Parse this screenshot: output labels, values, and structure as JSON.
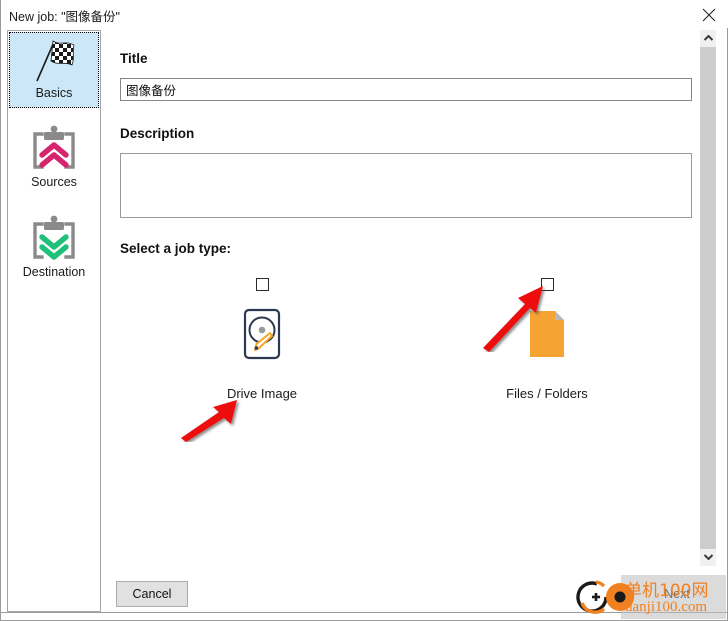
{
  "window": {
    "title": "New job: \"图像备份\"",
    "close_icon": "close-icon"
  },
  "sidebar": {
    "items": [
      {
        "label": "Basics",
        "icon": "checkered-flag-icon",
        "selected": true
      },
      {
        "label": "Sources",
        "icon": "clipboard-up-arrows-icon",
        "selected": false
      },
      {
        "label": "Destination",
        "icon": "clipboard-down-arrows-icon",
        "selected": false
      }
    ]
  },
  "form": {
    "title_label": "Title",
    "title_value": "图像备份",
    "title_placeholder": "",
    "description_label": "Description",
    "description_value": "",
    "description_placeholder": "",
    "jobtype_label": "Select a job type:"
  },
  "job_types": [
    {
      "caption": "Drive Image",
      "icon": "hard-drive-icon",
      "checked": false
    },
    {
      "caption": "Files / Folders",
      "icon": "document-file-icon",
      "checked": false
    }
  ],
  "footer": {
    "cancel_label": "Cancel",
    "next_label": "Next"
  },
  "scrollbar": {
    "up_icon": "chevron-up-icon",
    "down_icon": "chevron-down-icon"
  },
  "watermark": {
    "cn_text": "单机100网",
    "url_text": "danji100.com"
  },
  "colors": {
    "selected_tab_bg": "#cce8f8",
    "sources_accent": "#d6246e",
    "destination_accent": "#21c07a",
    "drive_accent": "#f5a623",
    "file_accent": "#f5a434",
    "annotation": "#ee1111",
    "watermark": "#f08020"
  }
}
